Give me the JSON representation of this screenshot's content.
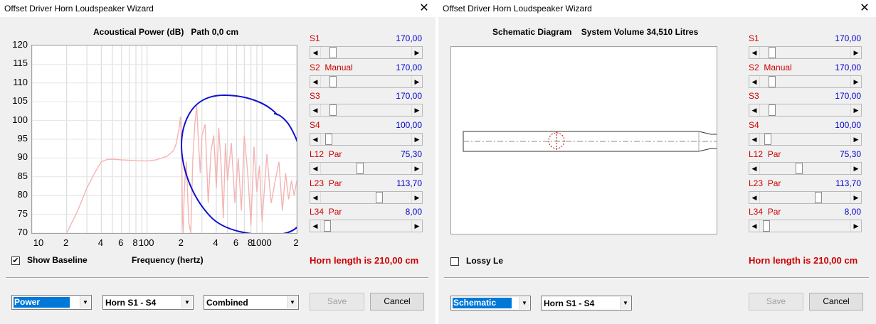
{
  "left": {
    "title": "Offset Driver Horn Loudspeaker Wizard",
    "close": "✕",
    "chart_title": "Acoustical Power (dB)   Path 0,0 cm",
    "show_baseline_label": "Show Baseline",
    "show_baseline_checked": true,
    "x_axis_label": "Frequency (hertz)",
    "horn_length": "Horn length is 210,00 cm",
    "combo1": "Power",
    "combo2": "Horn S1 - S4",
    "combo3": "Combined",
    "save": "Save",
    "cancel": "Cancel"
  },
  "right": {
    "title": "Offset Driver Horn Loudspeaker Wizard",
    "close": "✕",
    "diagram_title": "Schematic Diagram    System Volume 34,510 Litres",
    "lossy_label": "Lossy Le",
    "lossy_checked": false,
    "horn_length": "Horn length is 210,00 cm",
    "combo1": "Schematic",
    "combo2": "Horn S1 - S4",
    "save": "Save",
    "cancel": "Cancel"
  },
  "sliders": [
    {
      "name": "S1",
      "suffix": "",
      "value": "170,00",
      "pos": 0.1
    },
    {
      "name": "S2",
      "suffix": "Manual",
      "value": "170,00",
      "pos": 0.1
    },
    {
      "name": "S3",
      "suffix": "",
      "value": "170,00",
      "pos": 0.1
    },
    {
      "name": "S4",
      "suffix": "",
      "value": "100,00",
      "pos": 0.05
    },
    {
      "name": "L12",
      "suffix": "Par",
      "value": "75,30",
      "pos": 0.43
    },
    {
      "name": "L23",
      "suffix": "Par",
      "value": "113,70",
      "pos": 0.66
    },
    {
      "name": "L34",
      "suffix": "Par",
      "value": "8,00",
      "pos": 0.03
    }
  ],
  "chart_data": {
    "type": "line",
    "title": "Acoustical Power (dB)   Path 0,0 cm",
    "xlabel": "Frequency (hertz)",
    "ylabel": "",
    "x_scale": "log",
    "xlim": [
      10,
      2000
    ],
    "ylim": [
      70,
      120
    ],
    "y_ticks": [
      70,
      75,
      80,
      85,
      90,
      95,
      100,
      105,
      110,
      115,
      120
    ],
    "x_tick_labels": [
      "10",
      "2",
      "4",
      "6",
      "8",
      "100",
      "2",
      "4",
      "6",
      "8",
      "1000",
      "2"
    ],
    "grid": true,
    "series": [
      {
        "color": "#f4b4b4",
        "x": [
          20,
          25,
          30,
          35,
          40,
          45,
          50,
          60,
          80,
          100,
          120,
          150,
          170,
          180,
          190,
          195,
          200,
          203,
          206,
          210,
          215,
          220,
          230,
          240,
          250,
          260,
          270,
          280,
          290,
          300,
          320,
          340,
          360,
          380,
          400,
          420,
          440,
          460,
          480,
          500,
          540,
          580,
          620,
          660,
          700,
          750,
          800,
          850,
          900,
          950,
          1000,
          1100,
          1200,
          1300,
          1400,
          1500,
          1600,
          1700,
          1800,
          1900,
          2000
        ],
        "y": [
          70,
          76,
          82,
          86,
          89,
          89.6,
          89.7,
          89.5,
          89.3,
          89.2,
          89.5,
          90.5,
          92,
          94,
          98,
          101,
          92,
          74,
          70,
          80,
          86,
          89,
          73,
          70,
          90,
          99,
          104,
          94,
          86,
          96,
          99,
          78,
          92,
          96,
          82,
          98,
          88,
          74,
          94,
          84,
          94,
          78,
          90,
          76,
          96,
          86,
          72,
          93,
          81,
          88,
          73,
          91,
          78,
          84,
          89,
          76,
          86,
          79,
          84,
          80,
          84
        ]
      }
    ],
    "annotations": [
      "hand-drawn blue circle around high-frequency region"
    ]
  }
}
